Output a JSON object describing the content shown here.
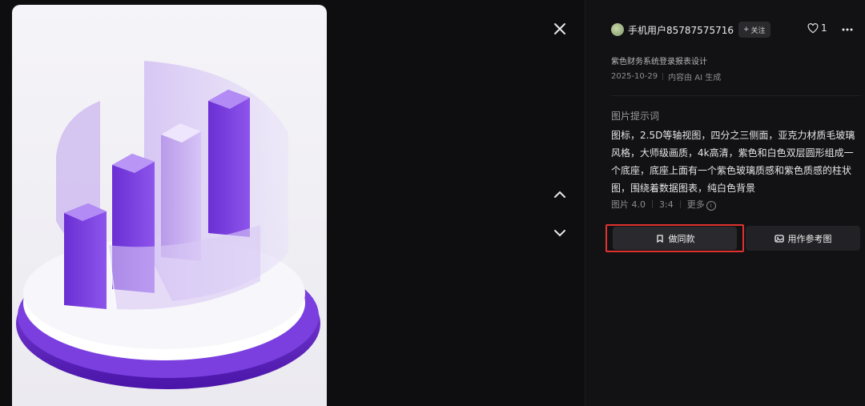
{
  "viewer": {
    "close_icon": "close-icon",
    "prev_icon": "chevron-up-icon",
    "next_icon": "chevron-down-icon"
  },
  "user": {
    "name": "手机用户85787575716",
    "follow_label": "关注"
  },
  "likes": {
    "count": "1"
  },
  "work": {
    "title": "紫色财务系统登录报表设计",
    "date": "2025-10-29",
    "ai_note": "内容由 AI 生成"
  },
  "prompt": {
    "label": "图片提示词",
    "text": "图标，2.5D等轴视图，四分之三侧面，亚克力材质毛玻璃风格，大师级画质，4k高清，紫色和白色双层圆形组成一个底座，底座上面有一个紫色玻璃质感和紫色质感的柱状图，围绕着数据图表，纯白色背景"
  },
  "stats": {
    "model": "图片 4.0",
    "ratio": "3:4",
    "more": "更多"
  },
  "actions": {
    "make_same": "做同款",
    "use_reference": "用作参考图"
  },
  "colors": {
    "background": "#111113",
    "highlight_border": "#e0322f",
    "purple": "#6a2bc9"
  }
}
